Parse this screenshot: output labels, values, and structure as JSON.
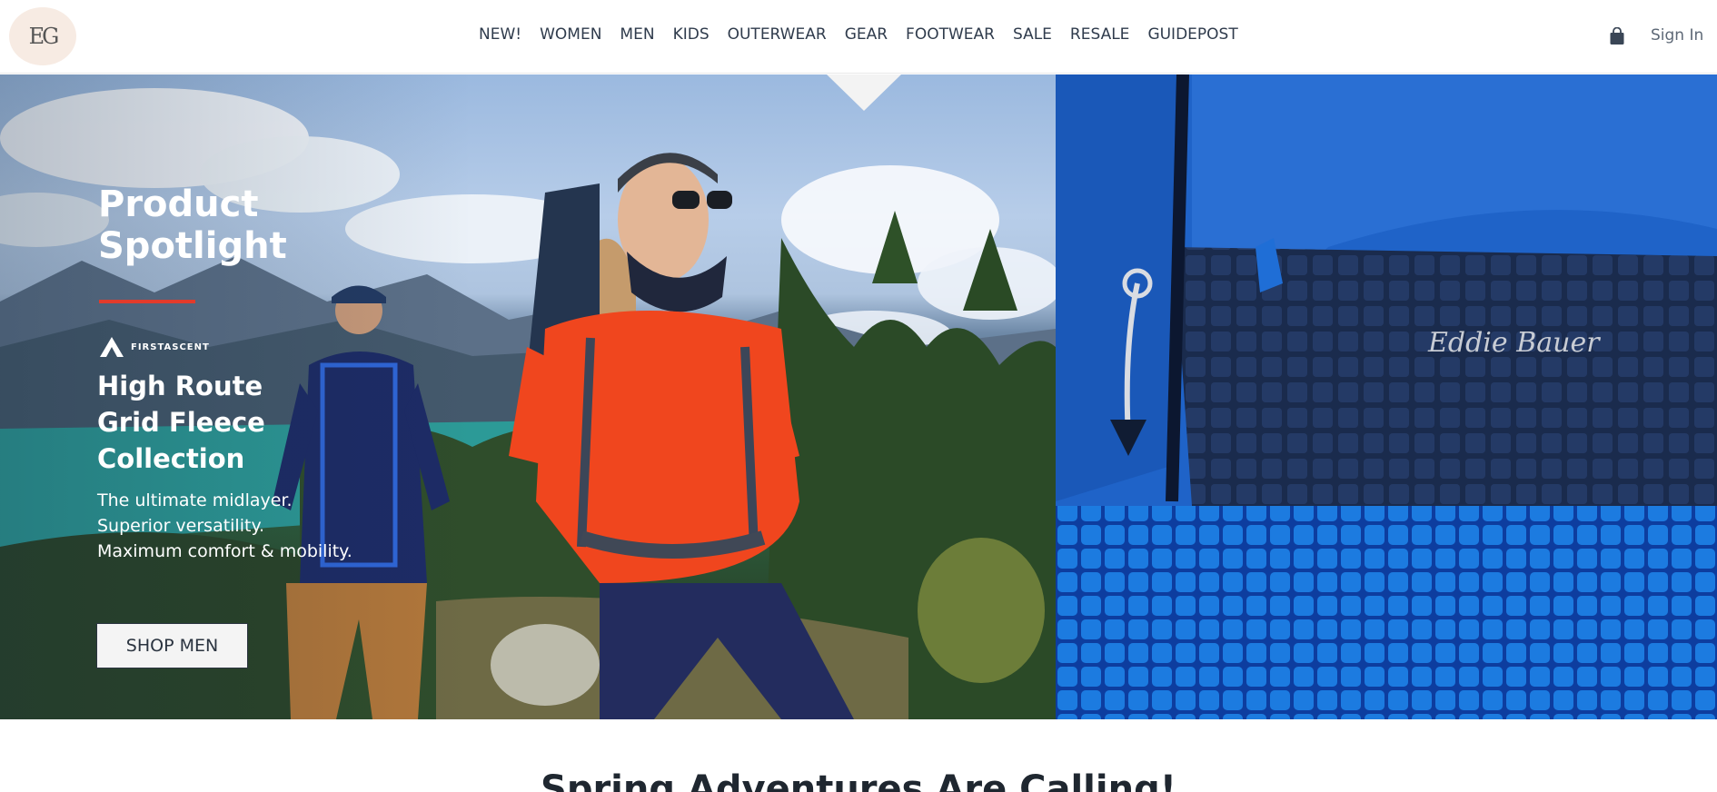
{
  "header": {
    "logo_text": "EG",
    "nav": [
      "NEW!",
      "WOMEN",
      "MEN",
      "KIDS",
      "OUTERWEAR",
      "GEAR",
      "FOOTWEAR",
      "SALE",
      "RESALE",
      "GUIDEPOST"
    ],
    "sign_in": "Sign In",
    "cart_icon": "shopping-bag-icon"
  },
  "hero": {
    "eyebrow": "Product Spotlight",
    "brand": "FIRSTASCENT",
    "headline": "High Route Grid Fleece Collection",
    "tagline": [
      "The ultimate midlayer.",
      "Superior versatility.",
      "Maximum comfort & mobility."
    ],
    "cta": "SHOP MEN",
    "jacket_logo": "Eddie Bauer",
    "colors": {
      "accent_rule": "#e23b2b",
      "fleece_blue": "#1f63c8",
      "navy": "#1b2a4a"
    }
  },
  "section": {
    "title": "Spring Adventures Are Calling!"
  }
}
